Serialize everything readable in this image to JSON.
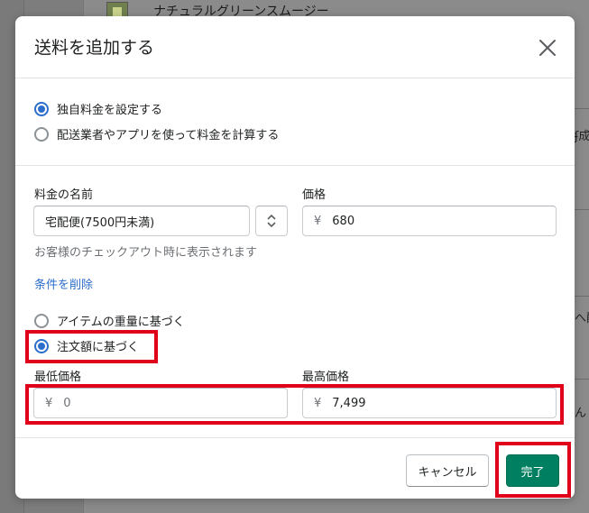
{
  "background": {
    "product_name": "ナチュラルグリーンスムージー",
    "right_fragments": [
      "ʄ成",
      "へ配",
      "ん"
    ]
  },
  "modal": {
    "title": "送料を追加する",
    "close_icon": "close-icon"
  },
  "rate_type": {
    "options": [
      {
        "label": "独自料金を設定する",
        "checked": true
      },
      {
        "label": "配送業者やアプリを使って料金を計算する",
        "checked": false
      }
    ]
  },
  "rate_name": {
    "label": "料金の名前",
    "value": "宅配便(7500円未満)",
    "help": "お客様のチェックアウト時に表示されます"
  },
  "price": {
    "label": "価格",
    "currency": "¥",
    "value": "680"
  },
  "conditions": {
    "remove_link": "条件を削除",
    "options": [
      {
        "label": "アイテムの重量に基づく",
        "checked": false
      },
      {
        "label": "注文額に基づく",
        "checked": true
      }
    ]
  },
  "min_price": {
    "label": "最低価格",
    "currency": "¥",
    "placeholder": "0"
  },
  "max_price": {
    "label": "最高価格",
    "currency": "¥",
    "value": "7,499"
  },
  "footer": {
    "cancel_label": "キャンセル",
    "done_label": "完了"
  },
  "colors": {
    "primary": "#008060",
    "radio_active": "#2c6ecb",
    "link": "#2c6ecb",
    "highlight": "#e0001a"
  }
}
